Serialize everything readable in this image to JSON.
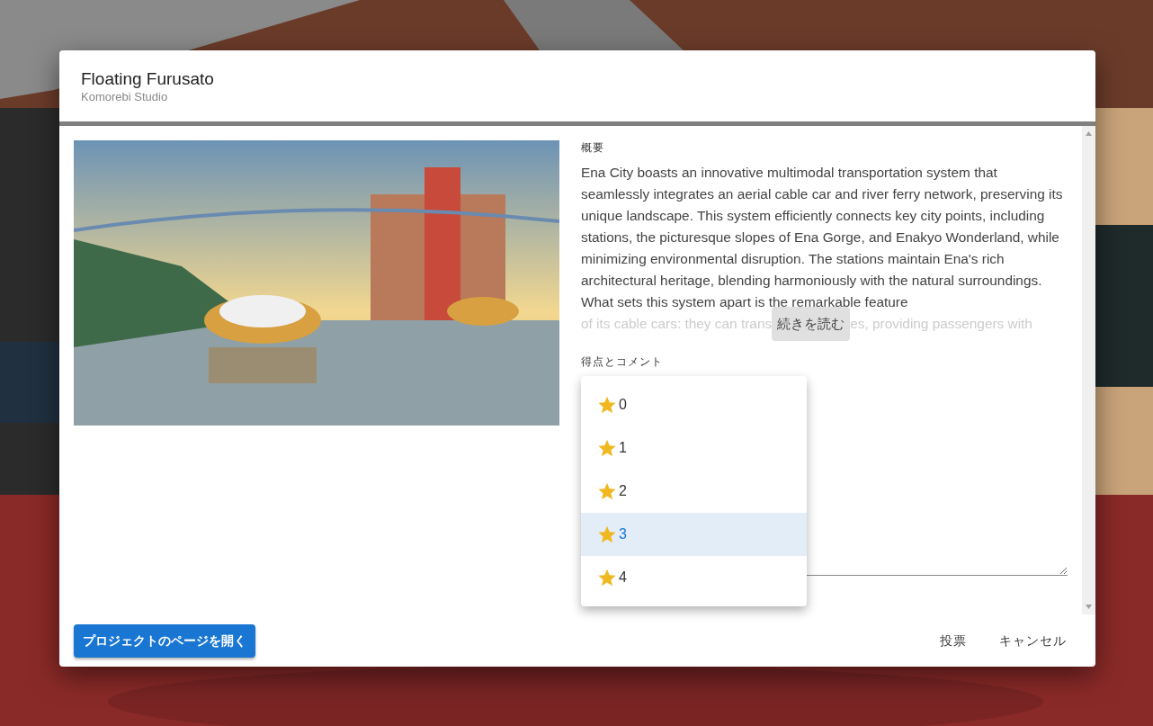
{
  "dialog": {
    "title": "Floating Furusato",
    "subtitle": "Komorebi Studio",
    "summary": {
      "label": "概要",
      "text": "Ena City boasts an innovative multimodal transportation system that seamlessly integrates an aerial cable car and river ferry network, preserving its unique landscape. This system efficiently connects key city points, including stations, the picturesque slopes of Ena Gorge, and Enakyo Wonderland, while minimizing environmental disruption. The stations maintain Ena's rich architectural heritage, blending harmoniously with the natural surroundings. What sets this system apart is the remarkable feature",
      "faded_text": [
        "of its cable cars: they can trans",
        "es, providing passengers with"
      ],
      "read_more_button": "続きを読む"
    },
    "rating": {
      "label": "得点とコメント",
      "menu": [
        {
          "label": "0",
          "selected": false
        },
        {
          "label": "1",
          "selected": false
        },
        {
          "label": "2",
          "selected": false
        },
        {
          "label": "3",
          "selected": true
        },
        {
          "label": "4",
          "selected": false
        }
      ]
    },
    "buttons": {
      "open_project": "プロジェクトのページを開く",
      "vote": "投票",
      "cancel": "キャンセル"
    }
  }
}
